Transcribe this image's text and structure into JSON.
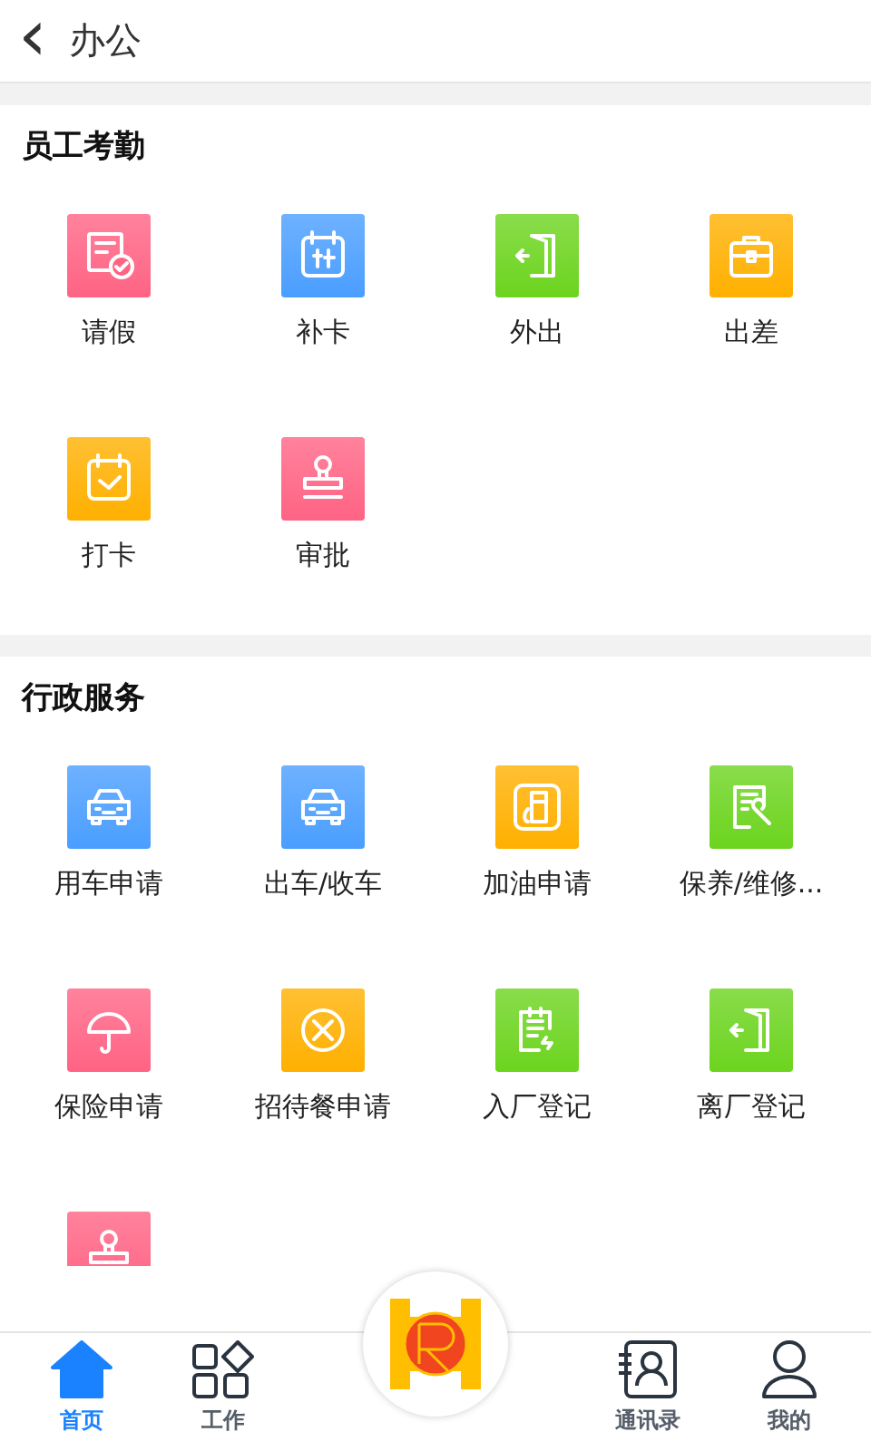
{
  "header": {
    "back_icon": "‹",
    "title": "办公"
  },
  "sections": [
    {
      "title": "员工考勤",
      "items": [
        {
          "label": "请假",
          "kind": "leave",
          "color": "#ff6384"
        },
        {
          "label": "补卡",
          "kind": "calendar",
          "color": "#4a9eff"
        },
        {
          "label": "外出",
          "kind": "door",
          "color": "#6cd41e"
        },
        {
          "label": "出差",
          "kind": "briefcase",
          "color": "#ffb000"
        },
        {
          "label": "打卡",
          "kind": "check",
          "color": "#ffb000"
        },
        {
          "label": "审批",
          "kind": "stamp",
          "color": "#ff6384"
        }
      ]
    },
    {
      "title": "行政服务",
      "items": [
        {
          "label": "用车申请",
          "kind": "car",
          "color": "#4a9eff"
        },
        {
          "label": "出车/收车",
          "kind": "car",
          "color": "#4a9eff"
        },
        {
          "label": "加油申请",
          "kind": "fuel",
          "color": "#ffb000"
        },
        {
          "label": "保养/维修...",
          "kind": "repair",
          "color": "#6cd41e"
        },
        {
          "label": "保险申请",
          "kind": "umbrella",
          "color": "#ff6384"
        },
        {
          "label": "招待餐申请",
          "kind": "meal",
          "color": "#ffb000"
        },
        {
          "label": "入厂登记",
          "kind": "clipboard",
          "color": "#6cd41e"
        },
        {
          "label": "离厂登记",
          "kind": "door",
          "color": "#6cd41e"
        },
        {
          "kind": "stamp",
          "color": "#ff6384"
        }
      ]
    }
  ],
  "tabs": [
    {
      "label": "首页",
      "kind": "home",
      "selected": true
    },
    {
      "label": "工作",
      "kind": "grid",
      "selected": false
    },
    {
      "kind": "logo",
      "selected": false
    },
    {
      "label": "通讯录",
      "kind": "contacts",
      "selected": false
    },
    {
      "label": "我的",
      "kind": "person",
      "selected": false
    }
  ]
}
